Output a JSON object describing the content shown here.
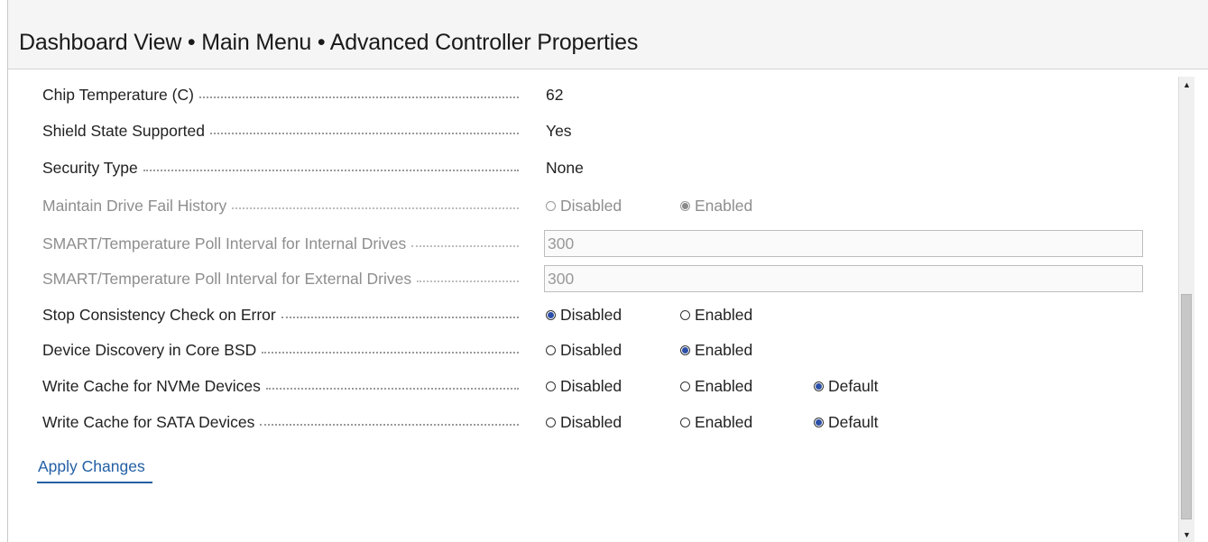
{
  "header": {
    "breadcrumb": "Dashboard View • Main Menu • Advanced Controller Properties"
  },
  "properties": [
    {
      "label": "Chip Temperature (C)",
      "value": "62"
    },
    {
      "label": "Shield State Supported",
      "value": "Yes"
    },
    {
      "label": "Security Type",
      "value": "None"
    },
    {
      "label": "Maintain Drive Fail History",
      "option1": "Disabled",
      "option2": "Enabled",
      "selected": "Enabled",
      "disabled": true
    },
    {
      "label": "SMART/Temperature Poll Interval for Internal Drives",
      "input_value": "300",
      "disabled": true
    },
    {
      "label": "SMART/Temperature Poll Interval for External Drives",
      "input_value": "300",
      "disabled": true
    },
    {
      "label": "Stop Consistency Check on Error",
      "option1": "Disabled",
      "option2": "Enabled",
      "selected": "Disabled"
    },
    {
      "label": "Device Discovery in Core BSD",
      "option1": "Disabled",
      "option2": "Enabled",
      "selected": "Enabled"
    },
    {
      "label": "Write Cache for NVMe Devices",
      "option1": "Disabled",
      "option2": "Enabled",
      "option3": "Default",
      "selected": "Default"
    },
    {
      "label": "Write Cache for SATA Devices",
      "option1": "Disabled",
      "option2": "Enabled",
      "option3": "Default",
      "selected": "Default"
    }
  ],
  "actions": {
    "apply_label": "Apply Changes"
  },
  "scrollbar": {
    "up_icon": "arrow-up-icon",
    "down_icon": "arrow-down-icon"
  }
}
